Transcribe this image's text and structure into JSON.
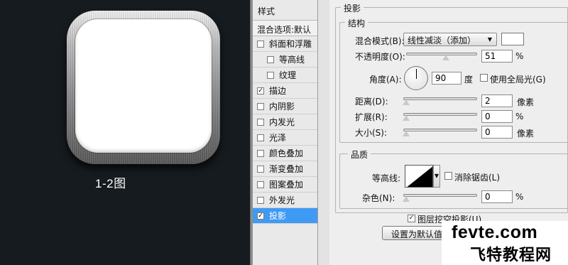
{
  "preview": {
    "caption": "1-2图"
  },
  "styles_panel": {
    "header": "样式",
    "blend_header": "混合选项:默认",
    "items": [
      {
        "label": "斜面和浮雕",
        "checked": false,
        "indent": false,
        "selected": false
      },
      {
        "label": "等高线",
        "checked": false,
        "indent": true,
        "selected": false
      },
      {
        "label": "纹理",
        "checked": false,
        "indent": true,
        "selected": false
      },
      {
        "label": "描边",
        "checked": true,
        "indent": false,
        "selected": false
      },
      {
        "label": "内阴影",
        "checked": false,
        "indent": false,
        "selected": false
      },
      {
        "label": "内发光",
        "checked": false,
        "indent": false,
        "selected": false
      },
      {
        "label": "光泽",
        "checked": false,
        "indent": false,
        "selected": false
      },
      {
        "label": "颜色叠加",
        "checked": false,
        "indent": false,
        "selected": false
      },
      {
        "label": "渐变叠加",
        "checked": false,
        "indent": false,
        "selected": false
      },
      {
        "label": "图案叠加",
        "checked": false,
        "indent": false,
        "selected": false
      },
      {
        "label": "外发光",
        "checked": false,
        "indent": false,
        "selected": false
      },
      {
        "label": "投影",
        "checked": true,
        "indent": false,
        "selected": true
      }
    ]
  },
  "drop_shadow": {
    "title": "投影",
    "structure": {
      "title": "结构",
      "blend_mode_label": "混合模式(B):",
      "blend_mode_value": "线性减淡（添加）",
      "shadow_color": "#ffffff",
      "opacity_label": "不透明度(O):",
      "opacity_value": "51",
      "opacity_unit": "%",
      "opacity_fraction": 0.51,
      "angle_label": "角度(A):",
      "angle_value": "90",
      "angle_unit": "度",
      "global_light_label": "使用全局光(G)",
      "global_light_checked": false,
      "distance_label": "距离(D):",
      "distance_value": "2",
      "distance_unit": "像素",
      "spread_label": "扩展(R):",
      "spread_value": "0",
      "spread_unit": "%",
      "size_label": "大小(S):",
      "size_value": "0",
      "size_unit": "像素"
    },
    "quality": {
      "title": "品质",
      "contour_label": "等高线:",
      "anti_alias_label": "消除锯齿(L)",
      "anti_alias_checked": false,
      "noise_label": "杂色(N):",
      "noise_value": "0",
      "noise_unit": "%"
    },
    "layer_knockout_label": "图层挖空投影(U)",
    "layer_knockout_checked": true,
    "make_default_label": "设置为默认值"
  },
  "watermark": {
    "line1": "fevte.com",
    "line2": "飞特教程网"
  },
  "colors": {
    "selection": "#3f9af4",
    "left_bg": "#161b1f"
  }
}
